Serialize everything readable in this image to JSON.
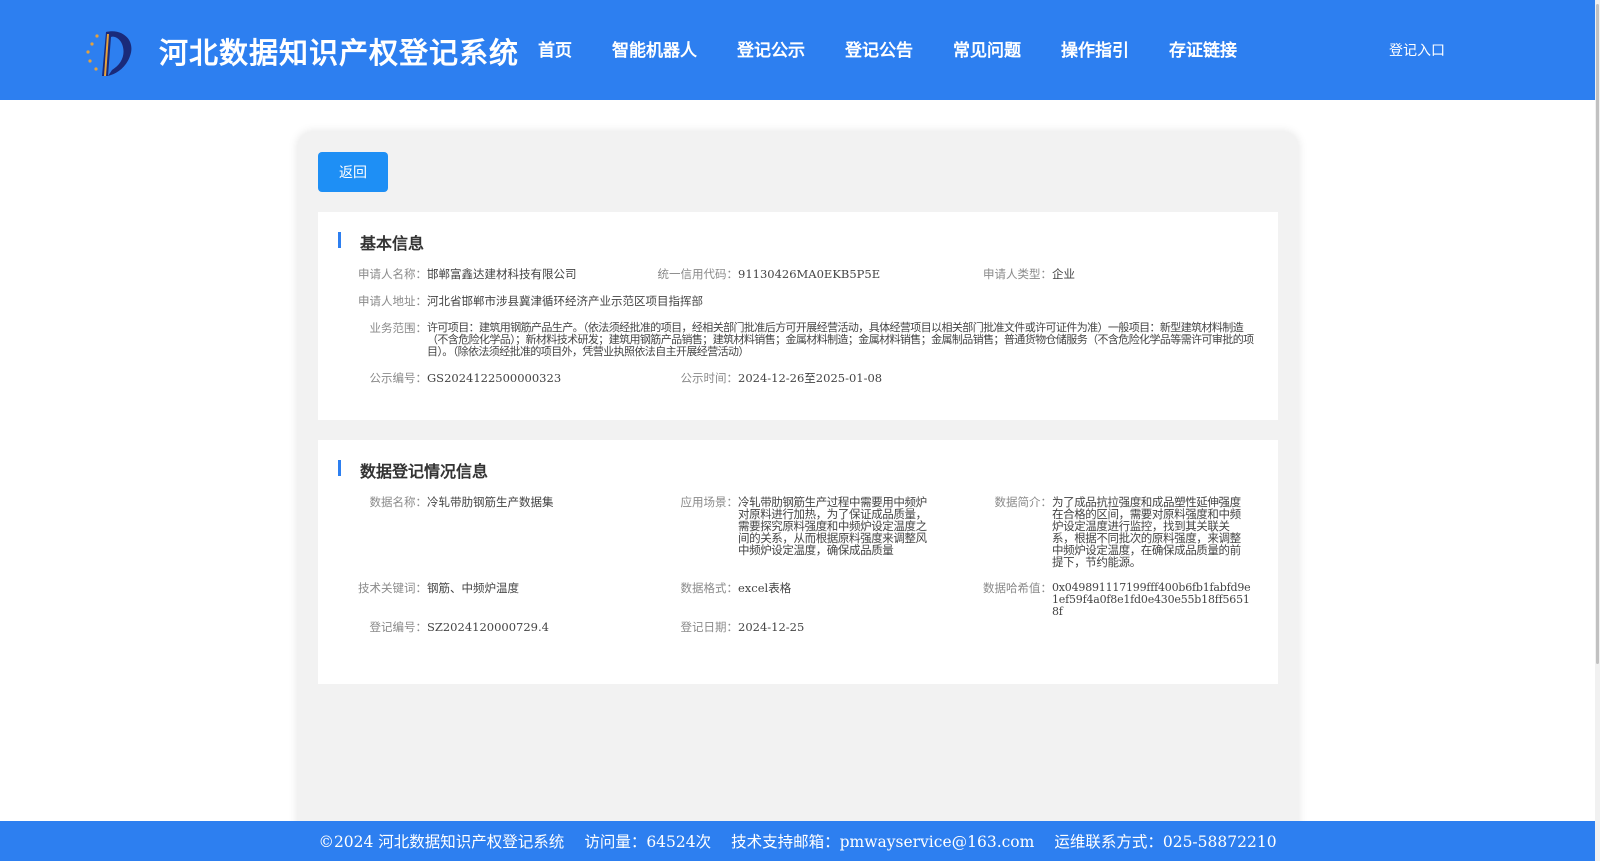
{
  "header": {
    "site_title": "河北数据知识产权登记系统",
    "logo_icon": "ip-logo-icon",
    "nav": [
      "首页",
      "智能机器人",
      "登记公示",
      "登记公告",
      "常见问题",
      "操作指引",
      "存证链接"
    ],
    "login": "登记入口",
    "bg_color": "#2d7ff0"
  },
  "back_button": "返回",
  "basic_info": {
    "title": "基本信息",
    "applicant_name_label": "申请人名称：",
    "applicant_name": "邯郸富鑫达建材科技有限公司",
    "credit_code_label": "统一信用代码：",
    "credit_code": "91130426MA0EKB5P5E",
    "applicant_type_label": "申请人类型：",
    "applicant_type": "企业",
    "address_label": "申请人地址：",
    "address": "河北省邯郸市涉县冀津循环经济产业示范区项目指挥部",
    "business_scope_label": "业务范围：",
    "business_scope": "许可项目：建筑用钢筋产品生产。（依法须经批准的项目，经相关部门批准后方可开展经营活动，具体经营项目以相关部门批准文件或许可证件为准）一般项目：新型建筑材料制造（不含危险化学品）；新材料技术研发；建筑用钢筋产品销售；建筑材料销售；金属材料制造；金属材料销售；金属制品销售；普通货物仓储服务（不含危险化学品等需许可审批的项目）。（除依法须经批准的项目外，凭营业执照依法自主开展经营活动）",
    "notice_no_label": "公示编号：",
    "notice_no": "GS2024122500000323",
    "notice_time_label": "公示时间：",
    "notice_time": "2024-12-26至2025-01-08"
  },
  "data_info": {
    "title": "数据登记情况信息",
    "data_name_label": "数据名称：",
    "data_name": "冷轧带肋钢筋生产数据集",
    "scenario_label": "应用场景：",
    "scenario": "冷轧带肋钢筋生产过程中需要用中频炉对原料进行加热，为了保证成品质量，需要探究原料强度和中频炉设定温度之间的关系，从而根据原料强度来调整风中频炉设定温度，确保成品质量",
    "summary_label": "数据简介：",
    "summary": "为了成品抗拉强度和成品塑性延伸强度在合格的区间，需要对原料强度和中频炉设定温度进行监控，找到其关联关系，根据不同批次的原料强度，来调整中频炉设定温度，在确保成品质量的前提下，节约能源。",
    "keywords_label": "技术关键词：",
    "keywords": "钢筋、中频炉温度",
    "format_label": "数据格式：",
    "format": "excel表格",
    "hash_label": "数据哈希值：",
    "hash": "0x049891117199fff400b6fb1fabfd9e1ef59f4a0f8e1fd0e430e55b18ff56518f",
    "reg_no_label": "登记编号：",
    "reg_no": "SZ2024120000729.4",
    "reg_date_label": "登记日期：",
    "reg_date": "2024-12-25"
  },
  "footer": {
    "copyright": "©2024 河北数据知识产权登记系统",
    "visits": "访问量：64524次",
    "email": "技术支持邮箱：pmwayservice@163.com",
    "phone": "运维联系方式：025-58872210"
  }
}
